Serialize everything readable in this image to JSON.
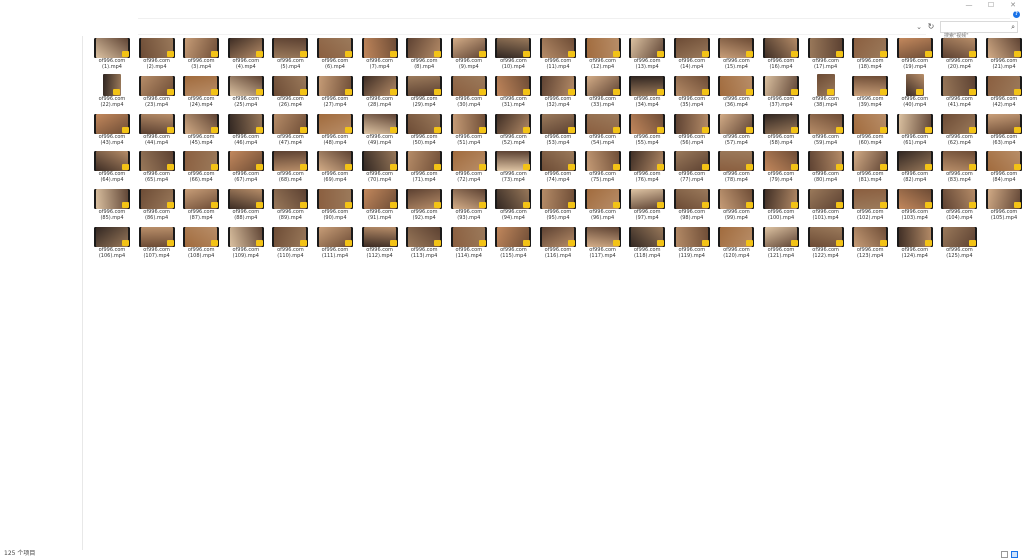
{
  "window": {
    "controls": [
      "—",
      "☐",
      "✕"
    ],
    "help_label": "?"
  },
  "address": {
    "chevron": "⌄",
    "refresh": "↻"
  },
  "search": {
    "placeholder": "搜索\"视频\""
  },
  "files": {
    "prefix": "of996.com",
    "extension": ".mp4",
    "count": 125,
    "per_row": 21,
    "portrait_items": [
      22,
      38,
      40
    ]
  },
  "statusbar": {
    "item_count": "125 个项目"
  },
  "thumb_palette": [
    "#a06a3c",
    "#c58a5e",
    "#6b4a34",
    "#d7b08a",
    "#3a2a22",
    "#b98f6a",
    "#8a5e3f",
    "#e1c7a6",
    "#5a3f30",
    "#caa07a",
    "#2e2420",
    "#9c7b5c"
  ]
}
